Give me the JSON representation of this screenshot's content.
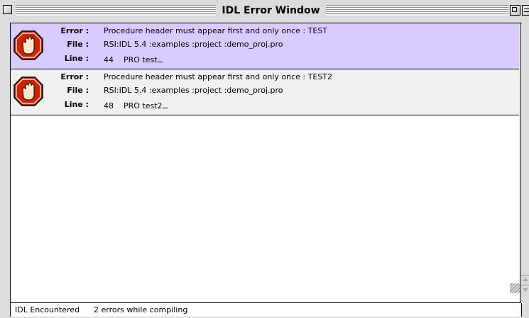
{
  "window": {
    "title": "IDL Error Window"
  },
  "labels": {
    "error": "Error :",
    "file": "File :",
    "line": "Line :"
  },
  "errors": [
    {
      "message": "Procedure header must appear first and only once : TEST",
      "file": "RSI:IDL 5.4 :examples :project :demo_proj.pro",
      "line_number": "44",
      "line_text": "PRO test",
      "selected": true
    },
    {
      "message": "Procedure header must appear first and only once : TEST2",
      "file": "RSI:IDL 5.4 :examples :project :demo_proj.pro",
      "line_number": "48",
      "line_text": "PRO test2",
      "selected": false
    }
  ],
  "status": {
    "left": "IDL Encountered",
    "right": "2 errors while compiling"
  },
  "icons": {
    "error_icon": "stop-hand-icon",
    "error_icon_color": "#cc2200"
  }
}
